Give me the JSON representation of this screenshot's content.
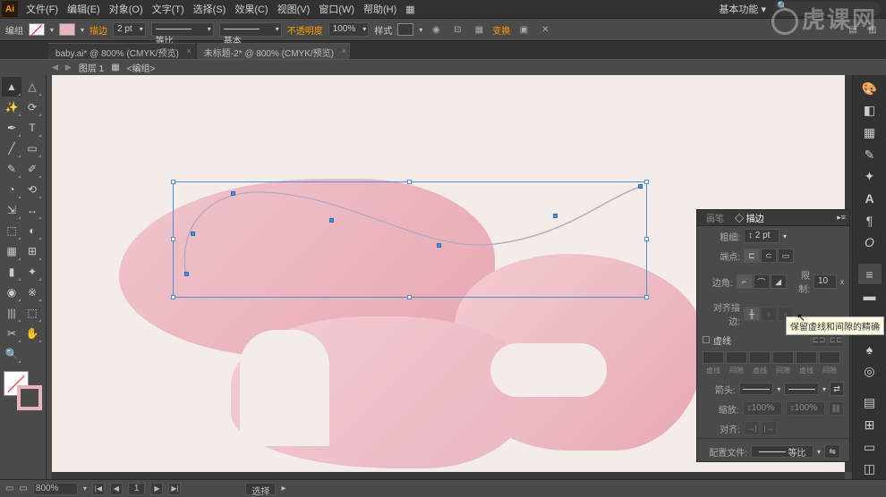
{
  "menubar": {
    "logo": "Ai",
    "items": [
      "文件(F)",
      "编辑(E)",
      "对象(O)",
      "文字(T)",
      "选择(S)",
      "效果(C)",
      "视图(V)",
      "窗口(W)",
      "帮助(H)"
    ],
    "workspace": "基本功能"
  },
  "controlbar": {
    "doc_label": "编组",
    "stroke_label": "描边",
    "stroke_weight": "2 pt",
    "uniform": "等比",
    "basic": "基本",
    "opacity_label": "不透明度",
    "opacity": "100%",
    "style_label": "样式",
    "transform_label": "变换"
  },
  "tabs": [
    {
      "label": "baby.ai* @ 800% (CMYK/预览)",
      "active": false
    },
    {
      "label": "未标题-2* @ 800% (CMYK/预览)",
      "active": true
    }
  ],
  "breadcrumb": {
    "layer": "图层 1",
    "group": "<编组>"
  },
  "tools": [
    "▲",
    "⬚",
    "✥",
    "T",
    "╱",
    "▭",
    "✎",
    "◔",
    "⟲",
    "⇲",
    "↔",
    "⬚",
    "◐",
    "✦",
    "⊞",
    "|||",
    "※",
    "◉",
    "⬢",
    "✂",
    "✋",
    "🔍"
  ],
  "stroke_panel": {
    "tab1": "画笔",
    "tab2": "◇ 描边",
    "weight_label": "粗细:",
    "weight_value": "2 pt",
    "cap_label": "端点:",
    "corner_label": "边角:",
    "limit_label": "限制:",
    "limit_value": "10",
    "align_label": "对齐描边:",
    "dashed_label": "虚线",
    "dash_labels": [
      "虚线",
      "间隙",
      "虚线",
      "间隙",
      "虚线",
      "间隙"
    ],
    "arrow_label": "箭头:",
    "scale_label": "缩放:",
    "scale_value1": "100%",
    "scale_value2": "100%",
    "align2_label": "对齐:",
    "profile_label": "配置文件:",
    "profile_value": "等比"
  },
  "tooltip": "保留虚线和间隙的精确",
  "statusbar": {
    "zoom": "800%",
    "page": "1",
    "tool": "选择"
  },
  "watermark": "虎课网",
  "chart_data": null
}
